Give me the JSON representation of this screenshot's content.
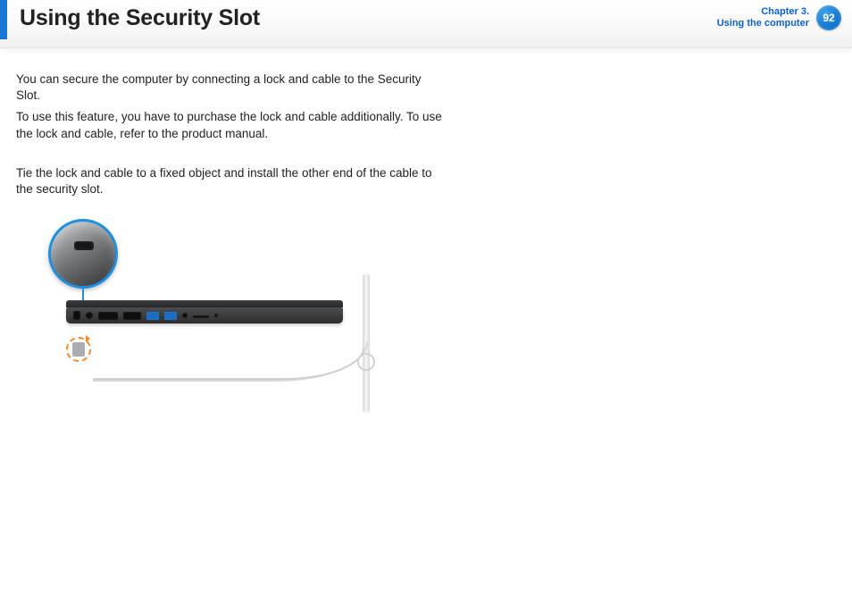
{
  "header": {
    "title": "Using the Security Slot",
    "chapter_line1": "Chapter 3.",
    "chapter_line2": "Using the computer",
    "page_number": "92"
  },
  "body": {
    "para1": "You can secure the computer by connecting a lock and cable to the Security Slot.",
    "para2": "To use this feature, you have to purchase the lock and cable additionally. To use the lock and cable, refer to the product manual.",
    "para3": "Tie the lock and cable to a fixed object and install the other end of the cable to the security slot."
  },
  "colors": {
    "accent": "#1a77d4",
    "link": "#0f62c9",
    "turn_arrow": "#f08a2c"
  }
}
